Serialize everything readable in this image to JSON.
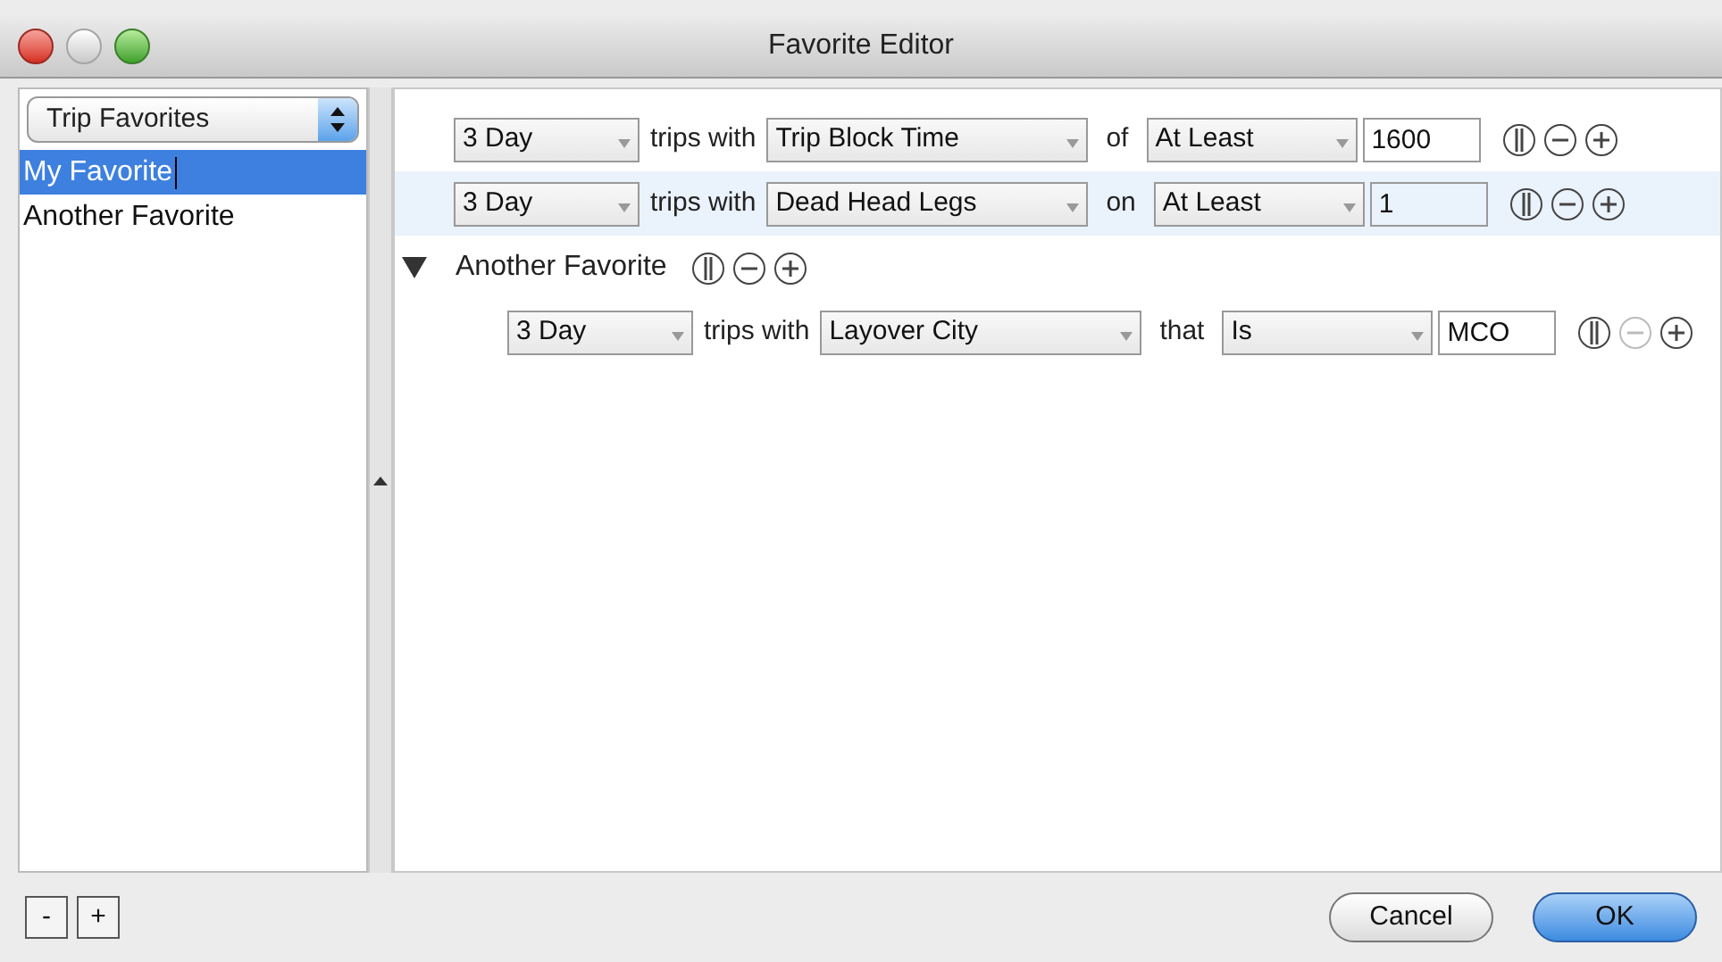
{
  "window": {
    "title": "Favorite Editor"
  },
  "sidebar": {
    "dropdown": "Trip Favorites",
    "items": [
      {
        "label": "My Favorite",
        "selected": true
      },
      {
        "label": "Another Favorite",
        "selected": false
      }
    ]
  },
  "rules": [
    {
      "kind": "rule",
      "duration": "3 Day",
      "connector": "trips with",
      "attribute": "Trip Block Time",
      "preposition": "of",
      "comparator": "At Least",
      "value": "1600",
      "selected": false,
      "remove_disabled": false
    },
    {
      "kind": "rule",
      "duration": "3 Day",
      "connector": "trips with",
      "attribute": "Dead Head Legs",
      "preposition": "on",
      "comparator": "At Least",
      "value": "1",
      "selected": true,
      "remove_disabled": false
    },
    {
      "kind": "group",
      "label": "Another Favorite",
      "expanded": true,
      "children": [
        {
          "kind": "rule",
          "duration": "3 Day",
          "connector": "trips with",
          "attribute": "Layover City",
          "preposition": "that",
          "comparator": "Is",
          "value": "MCO",
          "selected": false,
          "remove_disabled": true
        }
      ]
    }
  ],
  "list_buttons": [
    "-",
    "+"
  ],
  "buttons": [
    {
      "label": "Cancel",
      "default": false
    },
    {
      "label": "OK",
      "default": true
    }
  ]
}
